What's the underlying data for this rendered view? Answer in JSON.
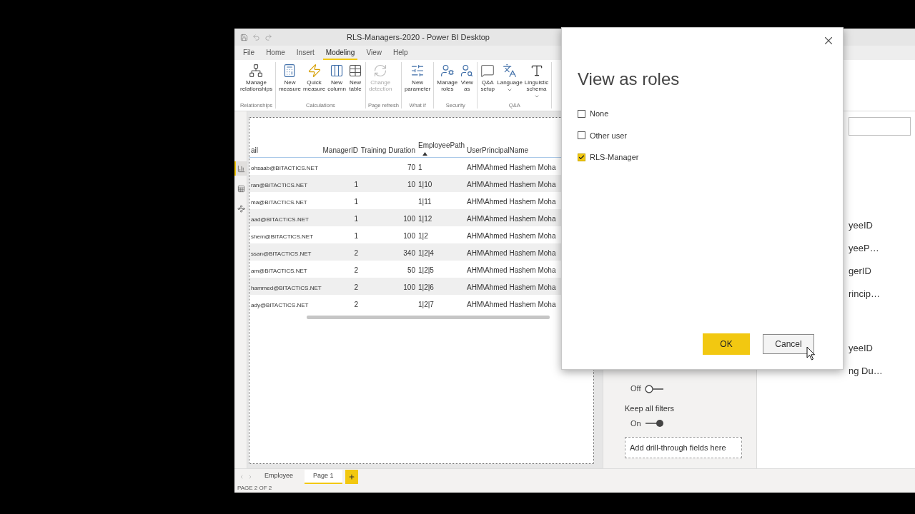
{
  "window": {
    "title": "RLS-Managers-2020 - Power BI Desktop"
  },
  "ribbon": {
    "tabs": [
      {
        "label": "File",
        "selected": false
      },
      {
        "label": "Home",
        "selected": false
      },
      {
        "label": "Insert",
        "selected": false
      },
      {
        "label": "Modeling",
        "selected": true
      },
      {
        "label": "View",
        "selected": false
      },
      {
        "label": "Help",
        "selected": false
      }
    ],
    "groups": [
      {
        "label": "Relationships",
        "buttons": [
          {
            "label": "Manage relationships",
            "disabled": false,
            "dropdown": false
          }
        ]
      },
      {
        "label": "Calculations",
        "buttons": [
          {
            "label": "New measure",
            "disabled": false,
            "dropdown": false
          },
          {
            "label": "Quick measure",
            "disabled": false,
            "dropdown": false
          },
          {
            "label": "New column",
            "disabled": false,
            "dropdown": false
          },
          {
            "label": "New table",
            "disabled": false,
            "dropdown": false
          }
        ]
      },
      {
        "label": "Page refresh",
        "buttons": [
          {
            "label": "Change detection",
            "disabled": true,
            "dropdown": false
          }
        ]
      },
      {
        "label": "What if",
        "buttons": [
          {
            "label": "New parameter",
            "disabled": false,
            "dropdown": false
          }
        ]
      },
      {
        "label": "Security",
        "buttons": [
          {
            "label": "Manage roles",
            "disabled": false,
            "dropdown": false
          },
          {
            "label": "View as",
            "disabled": false,
            "dropdown": false
          }
        ]
      },
      {
        "label": "Q&A",
        "buttons": [
          {
            "label": "Q&A setup",
            "disabled": false,
            "dropdown": false
          },
          {
            "label": "Language",
            "disabled": false,
            "dropdown": true
          },
          {
            "label": "Linguistic schema",
            "disabled": false,
            "dropdown": true
          }
        ]
      }
    ]
  },
  "view_nav": [
    {
      "kind": "report",
      "selected": true
    },
    {
      "kind": "data",
      "selected": false
    },
    {
      "kind": "model",
      "selected": false
    }
  ],
  "table": {
    "columns": [
      {
        "label": "ail",
        "sorted_ascending": false
      },
      {
        "label": "ManagerID",
        "sorted_ascending": false
      },
      {
        "label": "Training Duration",
        "sorted_ascending": false
      },
      {
        "label": "EmployeePath",
        "sorted_ascending": true
      },
      {
        "label": "UserPrincipalName",
        "sorted_ascending": false
      }
    ],
    "rows": [
      [
        "ohsaab@BITACTICS.NET",
        null,
        "70",
        "1",
        "AHM\\Ahmed Hashem Moha"
      ],
      [
        "ran@BITACTICS.NET",
        "1",
        "10",
        "1|10",
        "AHM\\Ahmed Hashem Moha"
      ],
      [
        "ma@BITACTICS.NET",
        "1",
        null,
        "1|11",
        "AHM\\Ahmed Hashem Moha"
      ],
      [
        "aad@BITACTICS.NET",
        "1",
        "100",
        "1|12",
        "AHM\\Ahmed Hashem Moha"
      ],
      [
        "shem@BITACTICS.NET",
        "1",
        "100",
        "1|2",
        "AHM\\Ahmed Hashem Moha"
      ],
      [
        "ssan@BITACTICS.NET",
        "2",
        "340",
        "1|2|4",
        "AHM\\Ahmed Hashem Moha"
      ],
      [
        "am@BITACTICS.NET",
        "2",
        "50",
        "1|2|5",
        "AHM\\Ahmed Hashem Moha"
      ],
      [
        "hammed@BITACTICS.NET",
        "2",
        "100",
        "1|2|6",
        "AHM\\Ahmed Hashem Moha"
      ],
      [
        "ady@BITACTICS.NET",
        "2",
        null,
        "1|2|7",
        "AHM\\Ahmed Hashem Moha"
      ]
    ]
  },
  "filters_pane": {
    "toggles": [
      {
        "label": "Off",
        "on": false
      },
      {
        "heading": "Keep all filters",
        "label": "On",
        "on": true
      }
    ],
    "drop_zone": {
      "placeholder": "Add drill-through fields here"
    }
  },
  "fields_pane": {
    "groups": [
      {
        "fields": [
          "yeeID",
          "yeeP…",
          "gerID",
          "rincip…"
        ]
      },
      {
        "fields": [
          "yeeID",
          "ng Du…"
        ]
      }
    ]
  },
  "page_tabs": [
    {
      "label": "Employee",
      "selected": false
    },
    {
      "label": "Page 1",
      "selected": true
    }
  ],
  "status_bar": {
    "text": "PAGE 2 OF 2"
  },
  "dialog": {
    "title": "View as roles",
    "options": [
      {
        "label": "None",
        "checked": false
      },
      {
        "label": "Other user",
        "checked": false
      },
      {
        "label": "RLS-Manager",
        "checked": true
      }
    ],
    "buttons": [
      {
        "label": "OK",
        "kind": "primary"
      },
      {
        "label": "Cancel",
        "kind": "secondary"
      }
    ]
  }
}
